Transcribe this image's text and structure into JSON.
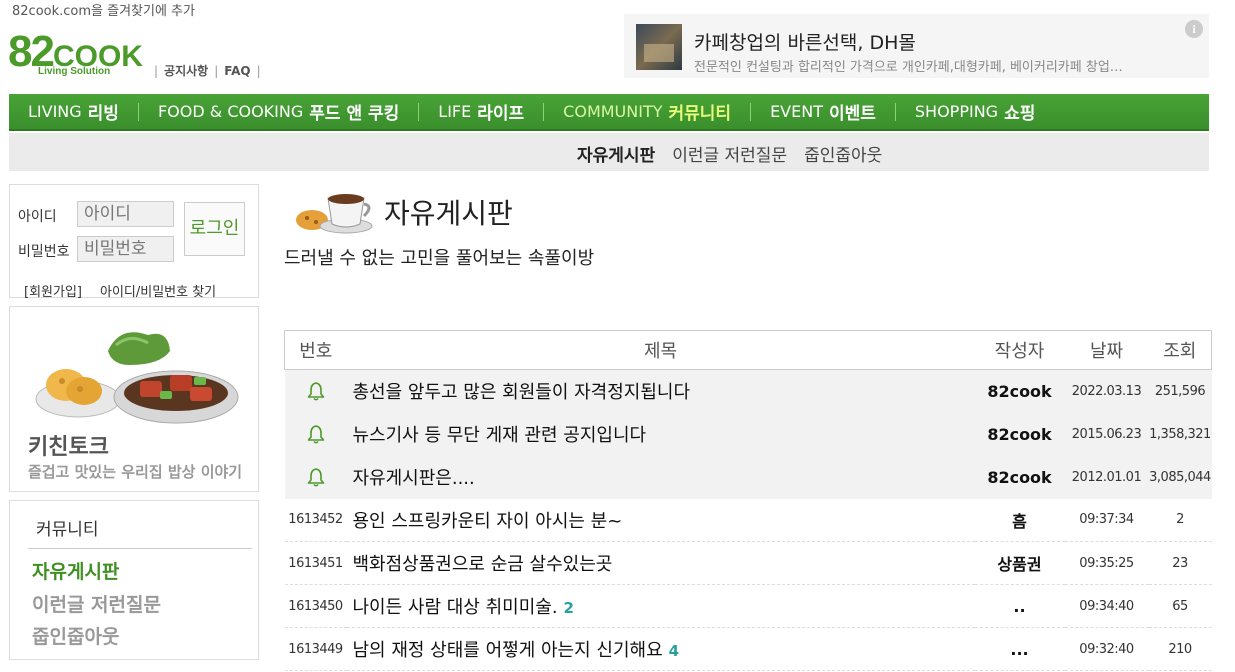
{
  "bookmark": "82cook.com을 즐겨찾기에 추가",
  "logo": {
    "main": "82",
    "cook": "COOK",
    "sub": "Living Solution"
  },
  "toplinks": [
    "공지사항",
    "FAQ"
  ],
  "ad": {
    "title": "카페창업의 바른선택, DH몰",
    "desc": "전문적인 컨설팅과 합리적인 가격으로 개인카페,대형카페, 베이커리카페 창업…",
    "info_icon": "i"
  },
  "gnb": [
    {
      "en": "LIVING",
      "ko": "리빙",
      "active": false
    },
    {
      "en": "FOOD & COOKING",
      "ko": "푸드 앤 쿠킹",
      "active": false
    },
    {
      "en": "LIFE",
      "ko": "라이프",
      "active": false
    },
    {
      "en": "COMMUNITY",
      "ko": "커뮤니티",
      "active": true
    },
    {
      "en": "EVENT",
      "ko": "이벤트",
      "active": false
    },
    {
      "en": "SHOPPING",
      "ko": "쇼핑",
      "active": false
    }
  ],
  "subnav": [
    {
      "label": "자유게시판",
      "active": true
    },
    {
      "label": "이런글 저런질문",
      "active": false
    },
    {
      "label": "줍인줍아웃",
      "active": false
    }
  ],
  "login": {
    "id_label": "아이디",
    "id_placeholder": "아이디",
    "pw_label": "비밀번호",
    "pw_placeholder": "비밀번호",
    "button": "로그인",
    "join": "[회원가입]",
    "find": "아이디/비밀번호 찾기"
  },
  "kitchen": {
    "title": "키친토크",
    "subtitle": "즐겁고 맛있는 우리집 밥상 이야기"
  },
  "community": {
    "heading": "커뮤니티",
    "items": [
      {
        "label": "자유게시판",
        "active": true
      },
      {
        "label": "이런글 저런질문",
        "active": false
      },
      {
        "label": "줍인줍아웃",
        "active": false
      }
    ]
  },
  "board": {
    "title": "자유게시판",
    "description": "드러낼 수 없는 고민을 풀어보는 속풀이방",
    "columns": [
      "번호",
      "제목",
      "작성자",
      "날짜",
      "조회"
    ],
    "notices": [
      {
        "title": "총선을 앞두고 많은 회원들이 자격정지됩니다",
        "writer": "82cook",
        "date": "2022.03.13",
        "hits": "251,596"
      },
      {
        "title": "뉴스기사 등 무단 게재 관련 공지입니다",
        "writer": "82cook",
        "date": "2015.06.23",
        "hits": "1,358,321"
      },
      {
        "title": "자유게시판은....",
        "writer": "82cook",
        "date": "2012.01.01",
        "hits": "3,085,044"
      }
    ],
    "posts": [
      {
        "num": "1613452",
        "title": "용인 스프링카운티 자이 아시는 분~",
        "comments": "",
        "writer": "흠",
        "date": "09:37:34",
        "hits": "2"
      },
      {
        "num": "1613451",
        "title": "백화점상품권으로 순금 살수있는곳",
        "comments": "",
        "writer": "상품권",
        "date": "09:35:25",
        "hits": "23"
      },
      {
        "num": "1613450",
        "title": "나이든 사람 대상 취미미술.",
        "comments": "2",
        "writer": "..",
        "date": "09:34:40",
        "hits": "65"
      },
      {
        "num": "1613449",
        "title": "남의 재정 상태를 어쩧게 아는지 신기해요",
        "comments": "4",
        "writer": "...",
        "date": "09:32:40",
        "hits": "210"
      }
    ]
  },
  "colors": {
    "brand_green": "#4c9a2a",
    "nav_green": "#3f9a30",
    "comment_teal": "#2a9fa0"
  }
}
